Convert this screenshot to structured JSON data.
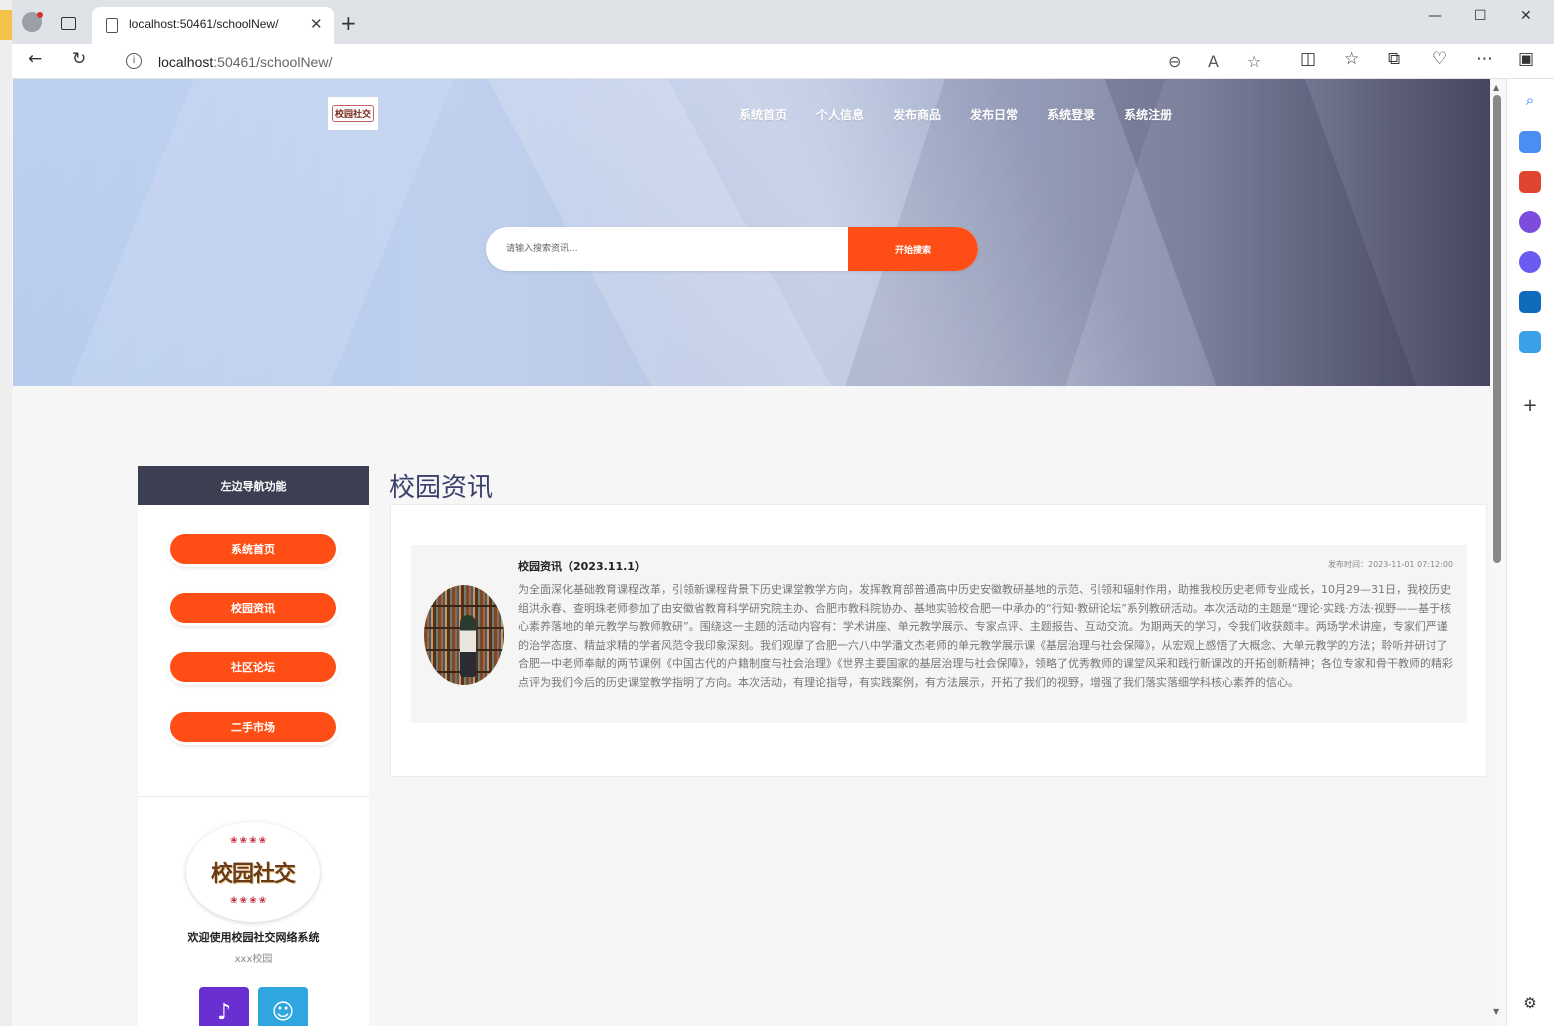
{
  "browser": {
    "tab_title": "localhost:50461/schoolNew/",
    "url_host": "localhost",
    "url_path": ":50461/schoolNew/"
  },
  "site": {
    "logo_alt": "校园社交",
    "nav": [
      "系统首页",
      "个人信息",
      "发布商品",
      "发布日常",
      "系统登录",
      "系统注册"
    ],
    "search": {
      "placeholder": "请输入搜索资讯...",
      "button": "开始搜索"
    }
  },
  "leftnav": {
    "header": "左边导航功能",
    "buttons": [
      "系统首页",
      "校园资讯",
      "社区论坛",
      "二手市场"
    ],
    "profile_logo": "校园社交",
    "welcome": "欢迎使用校园社交网络系统",
    "school": "xxx校园"
  },
  "main": {
    "section_title": "校园资讯",
    "news": [
      {
        "title": "校园资讯（2023.11.1）",
        "time": "发布时间：2023-11-01 07:12:00",
        "body": "为全面深化基础教育课程改革，引领新课程背景下历史课堂教学方向，发挥教育部普通高中历史安徽教研基地的示范、引领和辐射作用，助推我校历史老师专业成长，10月29—31日，我校历史组洪永春、查明珠老师参加了由安徽省教育科学研究院主办、合肥市教科院协办、基地实验校合肥一中承办的“行知·教研论坛”系列教研活动。本次活动的主题是“理论·实践·方法·视野——基于核心素养落地的单元教学与教师教研”。围绕这一主题的活动内容有：学术讲座、单元教学展示、专家点评、主题报告、互动交流。为期两天的学习，令我们收获颇丰。两场学术讲座，专家们严谨的治学态度、精益求精的学者风范令我印象深刻。我们观摩了合肥一六八中学潘文杰老师的单元教学展示课《基层治理与社会保障》，从宏观上感悟了大概念、大单元教学的方法；聆听并研讨了合肥一中老师奉献的两节课例《中国古代的户籍制度与社会治理》《世界主要国家的基层治理与社会保障》，领略了优秀教师的课堂风采和践行新课改的开拓创新精神；各位专家和骨干教师的精彩点评为我们今后的历史课堂教学指明了方向。本次活动，有理论指导，有实践案例，有方法展示，开拓了我们的视野，增强了我们落实落细学科核心素养的信心。"
      }
    ]
  },
  "colors": {
    "accent": "#fe4e16",
    "nav_header": "#3b3f51",
    "title": "#3b3f6b"
  }
}
